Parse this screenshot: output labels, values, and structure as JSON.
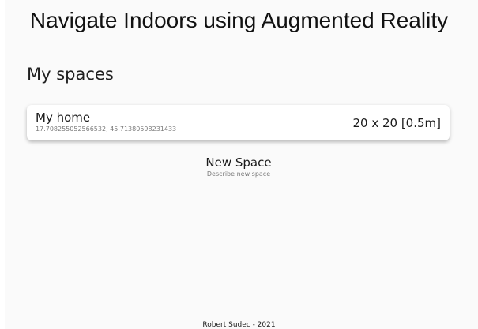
{
  "header": {
    "title": "Navigate Indoors using Augmented Reality"
  },
  "spaces": {
    "section_title": "My spaces",
    "items": [
      {
        "name": "My home",
        "coordinates": "17.708255052566532, 45.71380598231433",
        "size": "20 x 20 [0.5m]"
      }
    ]
  },
  "new_space": {
    "title": "New Space",
    "subtitle": "Describe new space"
  },
  "footer": {
    "text": "Robert Sudec - 2021"
  }
}
